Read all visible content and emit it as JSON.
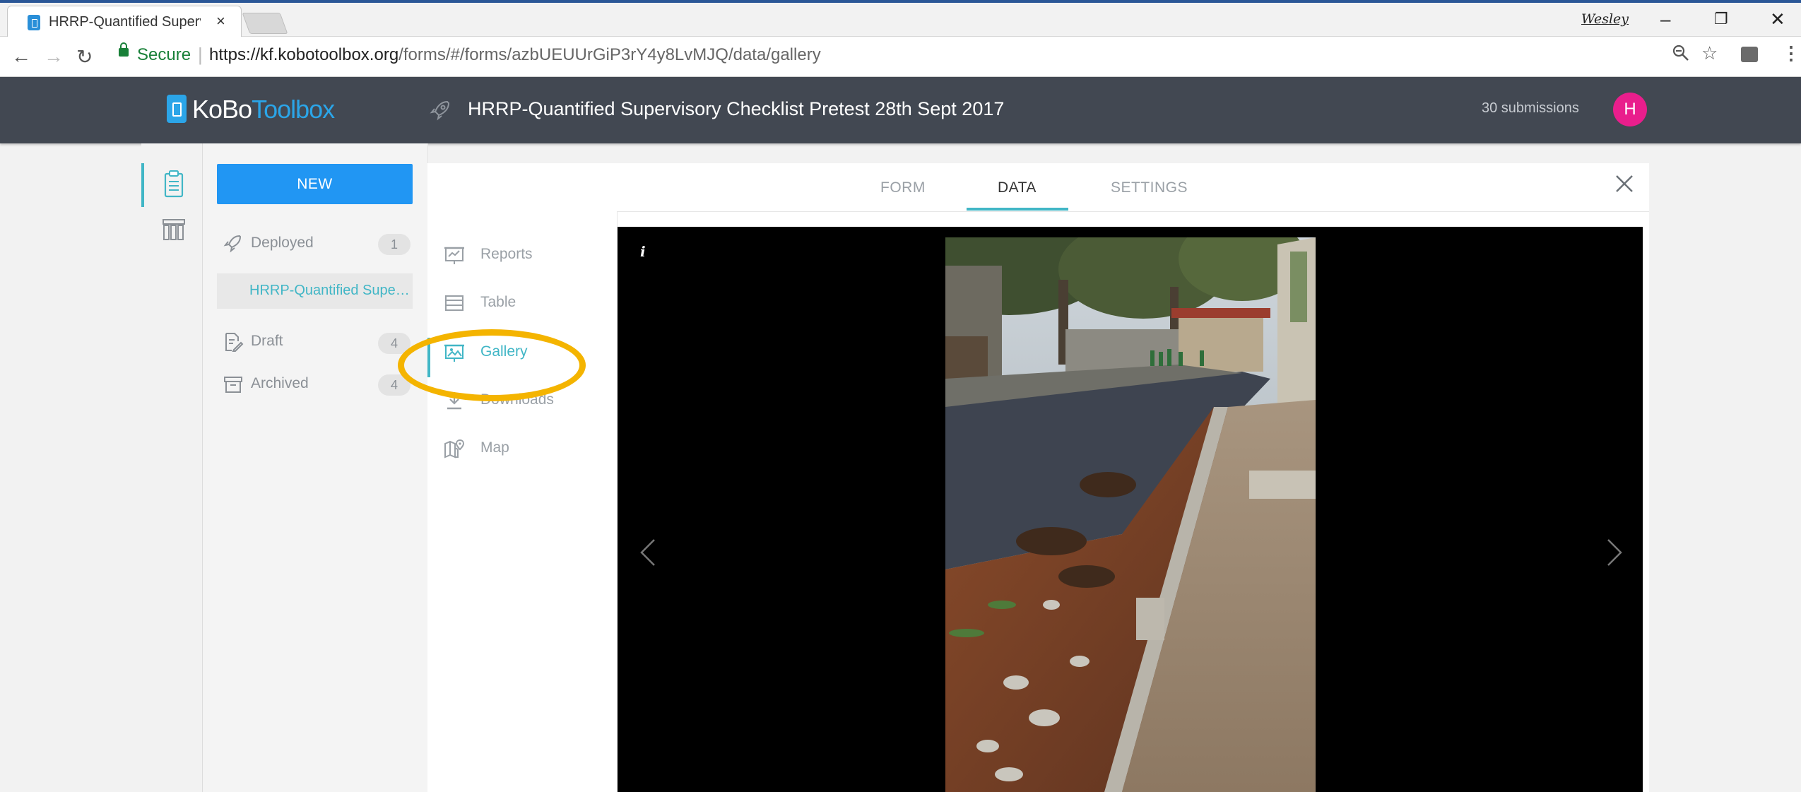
{
  "browser": {
    "tab_title": "HRRP-Quantified Superv",
    "window_user": "Wesley",
    "secure_label": "Secure",
    "url_host": "https://kf.kobotoolbox.org",
    "url_path": "/forms/#/forms/azbUEUUrGiP3rY4y8LvMJQ/data/gallery"
  },
  "header": {
    "logo_ko": "KoBo",
    "logo_toolbox": "Toolbox",
    "form_title": "HRRP-Quantified Supervisory Checklist Pretest 28th Sept 2017",
    "submissions": "30 submissions",
    "avatar_initial": "H",
    "avatar_color": "#e91e8c"
  },
  "sidebar": {
    "new_label": "NEW",
    "deployed_label": "Deployed",
    "deployed_count": "1",
    "selected_asset": "HRRP-Quantified Supervisory Checklist Pretest 28th Sept 2017",
    "draft_label": "Draft",
    "draft_count": "4",
    "archived_label": "Archived",
    "archived_count": "4"
  },
  "tabs": {
    "form": "FORM",
    "data": "DATA",
    "settings": "SETTINGS"
  },
  "subnav": {
    "reports": "Reports",
    "table": "Table",
    "gallery": "Gallery",
    "downloads": "Downloads",
    "map": "Map"
  },
  "gallery": {
    "info_label": "i"
  },
  "colors": {
    "accent": "#41b6c6",
    "primary_button": "#2196f3",
    "header_bg": "#424852",
    "annotation_circle": "#f4b400"
  }
}
